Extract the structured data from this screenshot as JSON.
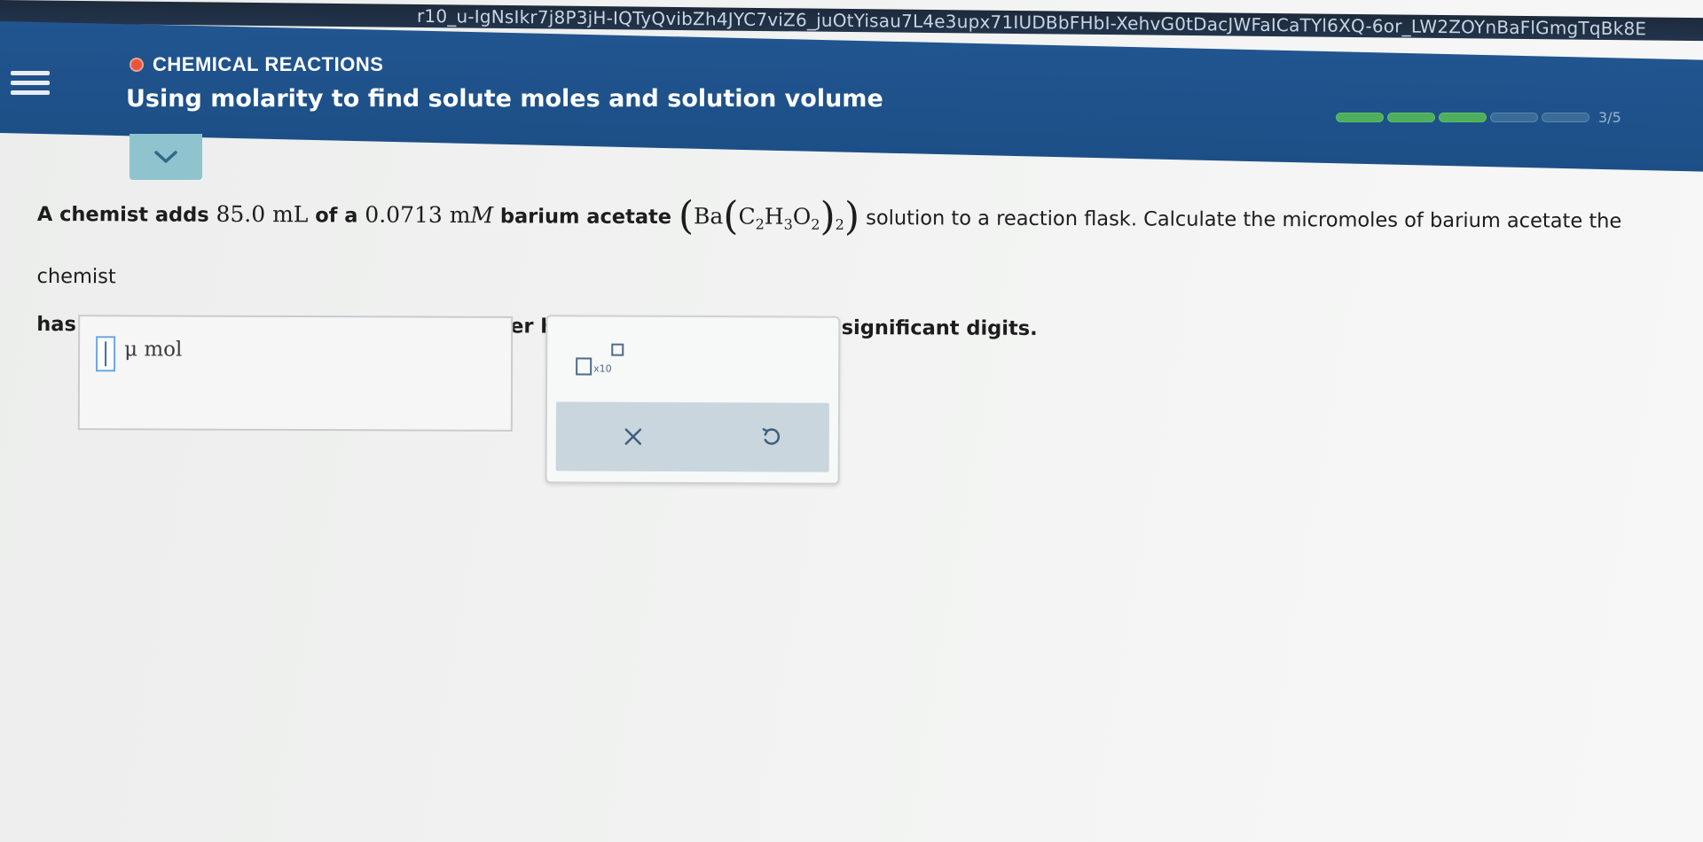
{
  "browser": {
    "url_fragment": "r10_u-IgNsIkr7j8P3jH-IQTyQvibZh4JYC7viZ6_juOtYisau7L4e3upx71IUDBbFHbI-XehvG0tDacJWFaICaTYl6XQ-6or_LW2ZOYnBaFlGmgTqBk8E"
  },
  "header": {
    "topic": "CHEMICAL REACTIONS",
    "lesson_title": "Using molarity to find solute moles and solution volume",
    "topic_dot_color": "#e8543c",
    "background_color": "#1f528b",
    "progress": {
      "filled_segments": 3,
      "total_segments": 5,
      "count_label": "3/5"
    }
  },
  "question": {
    "part1": "A chemist adds ",
    "volume": "85.0 mL",
    "part2": " of a ",
    "concentration": "0.0713 m",
    "concentration_unit": "M",
    "part3": " barium acetate ",
    "formula": {
      "ba": "Ba",
      "c": "C",
      "c_sub": "2",
      "h": "H",
      "h_sub": "3",
      "o": "O",
      "o_sub": "2",
      "outer_sub": "2"
    },
    "part4": " solution to a reaction flask. Calculate the micromoles of barium acetate the chemist",
    "line2": "has added to the flask. Be sure your answer has the correct number of significant digits."
  },
  "answer": {
    "value": "",
    "unit": "μ mol"
  },
  "tools": {
    "sci_notation_label": "x10",
    "clear_symbol": "×",
    "undo_symbol": "↺"
  }
}
